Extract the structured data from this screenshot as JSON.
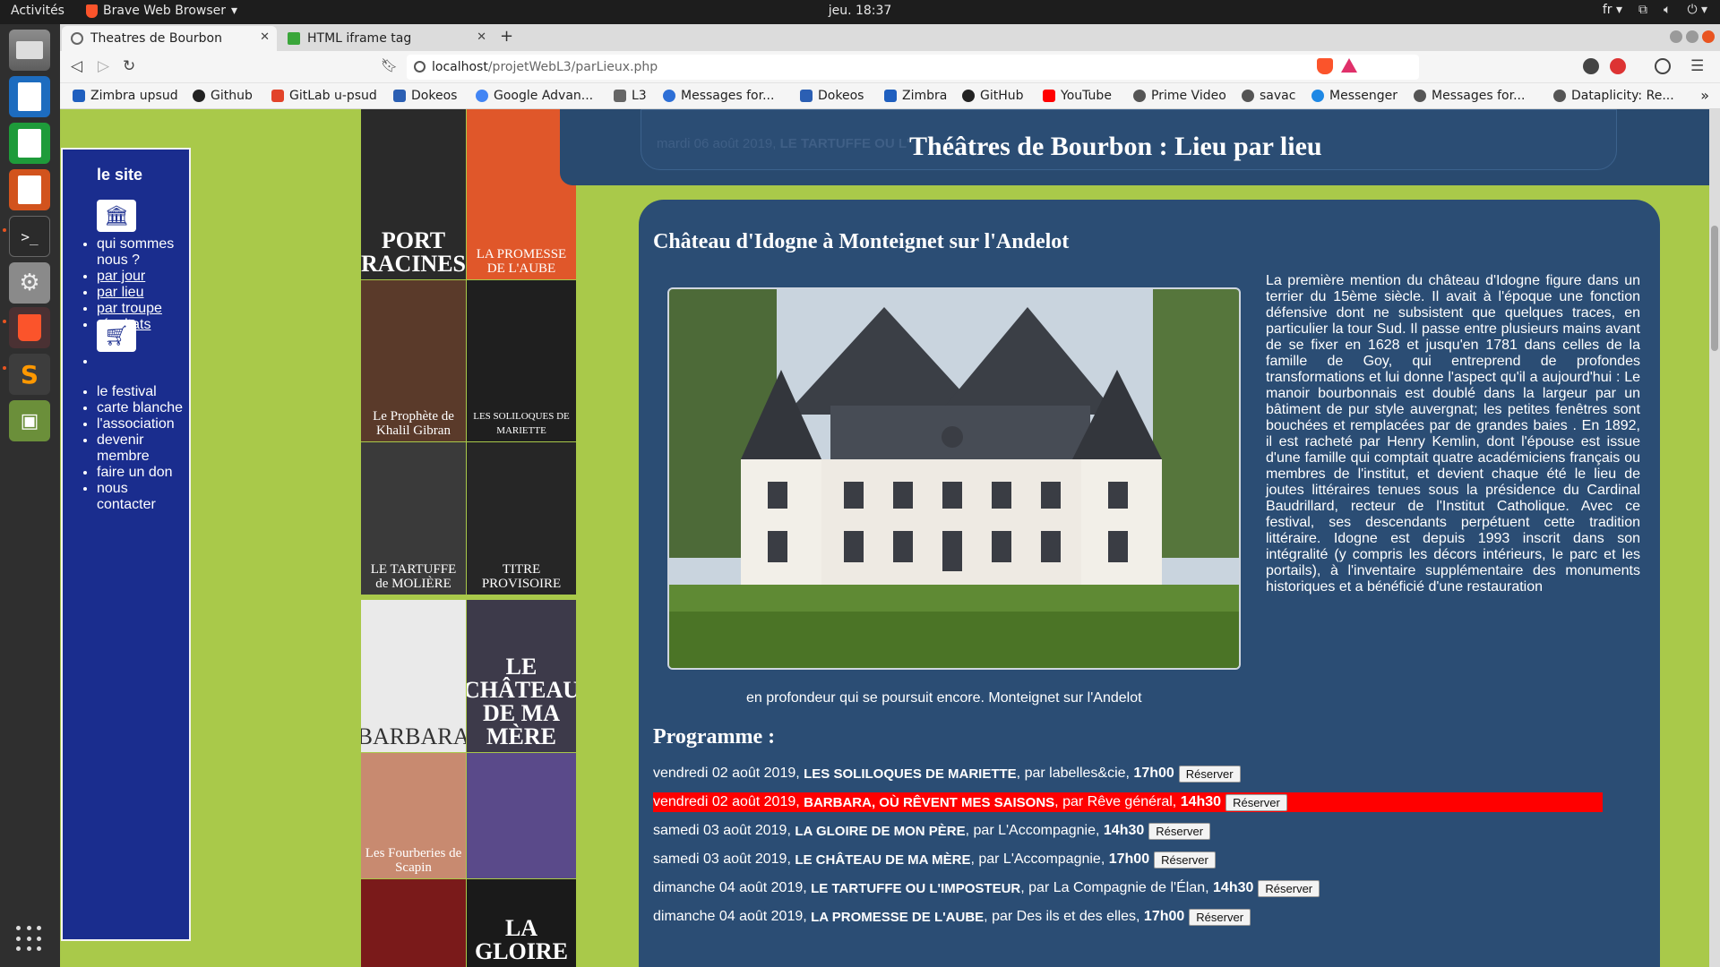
{
  "system": {
    "activities": "Activités",
    "app_name": "Brave Web Browser",
    "clock": "jeu. 18:37",
    "keyboard_layout": "fr"
  },
  "browser": {
    "tabs": [
      {
        "title": "Theatres de Bourbon",
        "active": true
      },
      {
        "title": "HTML iframe tag",
        "active": false
      }
    ],
    "url_host": "localhost",
    "url_path": "/projetWebL3/parLieux.php",
    "bookmarks": [
      {
        "label": "Zimbra upsud",
        "color": "#1f5fbf"
      },
      {
        "label": "Github",
        "color": "#222222"
      },
      {
        "label": "GitLab u-psud",
        "color": "#e24329"
      },
      {
        "label": "Dokeos",
        "color": "#2b5fb3"
      },
      {
        "label": "Google Advan...",
        "color": "#4285f4"
      },
      {
        "label": "L3",
        "color": "#666666"
      },
      {
        "label": "Messages for...",
        "color": "#2d6fd6"
      },
      {
        "label": "Dokeos",
        "color": "#2b5fb3"
      },
      {
        "label": "Zimbra",
        "color": "#1f5fbf"
      },
      {
        "label": "GitHub",
        "color": "#222222"
      },
      {
        "label": "YouTube",
        "color": "#ff0000"
      },
      {
        "label": "Prime Video",
        "color": "#555555"
      },
      {
        "label": "savac",
        "color": "#555555"
      },
      {
        "label": "Messenger",
        "color": "#1e88e5"
      },
      {
        "label": "Messages for...",
        "color": "#555555"
      },
      {
        "label": "Dataplicity: Re...",
        "color": "#555555"
      }
    ]
  },
  "sitenav": {
    "title": "le site",
    "icon1": "theatre-building-icon",
    "icon2": "shopping-cart-icon",
    "links": [
      "qui sommes nous ?",
      "par jour",
      "par lieu",
      "par troupe",
      "résultats"
    ],
    "items": [
      "le festival",
      "carte blanche",
      "l'association",
      "devenir membre",
      "faire un don",
      "nous contacter"
    ]
  },
  "posters": [
    {
      "title": "PORT RACINES",
      "bg": "#2a2a2a"
    },
    {
      "title": "LA PROMESSE DE L'AUBE",
      "bg": "#e0572a"
    },
    {
      "title": "Le Prophète de Khalil Gibran",
      "bg": "#5a3a2a"
    },
    {
      "title": "LES SOLILOQUES DE MARIETTE",
      "bg": "#1f1f1f"
    },
    {
      "title": "LE TARTUFFE de MOLIÈRE",
      "bg": "#3a3a3a"
    },
    {
      "title": "TITRE PROVISOIRE",
      "bg": "#262626"
    },
    {
      "title": "BARBARA",
      "bg": "#eaeaea"
    },
    {
      "title": "LE CHÂTEAU DE MA MÈRE",
      "bg": "#3d3a4a"
    },
    {
      "title": "Les Fourberies de Scapin",
      "bg": "#c88a70"
    },
    {
      "title": "",
      "bg": "#5a4a8a"
    },
    {
      "title": "",
      "bg": "#7a1a1a"
    },
    {
      "title": "LA GLOIRE",
      "bg": "#1a1a1a"
    }
  ],
  "header": {
    "title": "Théâtres de Bourbon : Lieu par lieu",
    "ghost_date": "mardi 06 août 2019,",
    "ghost_play": "LE TARTUFFE OU L'"
  },
  "lieu": {
    "name": "Château d'Idogne à Monteignet sur l'Andelot",
    "description": "La première mention du château d'Idogne figure dans un terrier du 15ème siècle. Il avait à l'époque une fonction défensive dont ne subsistent que quelques traces, en particulier la tour Sud. Il passe entre plusieurs mains avant de se fixer en 1628 et jusqu'en 1781 dans celles de la famille de Goy, qui entreprend de profondes transformations et lui donne l'aspect qu'il a aujourd'hui : Le manoir bourbonnais est doublé dans la largeur par un bâtiment de pur style auvergnat; les petites fenêtres sont bouchées et remplacées par de grandes baies . En 1892, il est racheté par Henry Kemlin, dont l'épouse est issue d'une famille qui comptait quatre académiciens français ou membres de l'institut, et devient chaque été le lieu de joutes littéraires tenues sous la présidence du Cardinal Baudrillard, recteur de l'Institut Catholique. Avec ce festival, ses descendants perpétuent cette tradition littéraire. Idogne est depuis 1993 inscrit dans son intégralité (y compris les décors intérieurs, le parc et les portails), à l'inventaire supplémentaire des monuments historiques et a bénéficié d'une restauration",
    "description_end": "en profondeur qui se poursuit encore. Monteignet sur l'Andelot",
    "programme_title": "Programme :"
  },
  "programme": [
    {
      "date": "vendredi 02 août 2019,",
      "play": "LES SOLILOQUES DE MARIETTE",
      "troupe": ", par labelles&cie,",
      "time": "17h00",
      "button": "Réserver",
      "highlight": false
    },
    {
      "date": "vendredi 02 août 2019,",
      "play": "BARBARA, OÙ RÊVENT MES SAISONS",
      "troupe": " , par Rêve général,",
      "time": "14h30",
      "button": "Réserver",
      "highlight": true
    },
    {
      "date": "samedi 03 août 2019,",
      "play": "LA GLOIRE DE MON PÈRE",
      "troupe": ", par L'Accompagnie,",
      "time": "14h30",
      "button": "Réserver",
      "highlight": false
    },
    {
      "date": "samedi 03 août 2019,",
      "play": "LE CHÂTEAU DE MA MÈRE",
      "troupe": ", par L'Accompagnie,",
      "time": "17h00",
      "button": "Réserver",
      "highlight": false
    },
    {
      "date": "dimanche 04 août 2019,",
      "play": "LE TARTUFFE OU L'IMPOSTEUR",
      "troupe": ", par La Compagnie de l'Élan,",
      "time": "14h30",
      "button": "Réserver",
      "highlight": false
    },
    {
      "date": "dimanche 04 août 2019,",
      "play": "LA PROMESSE DE L'AUBE",
      "troupe": ", par Des ils et des elles,",
      "time": "17h00",
      "button": "Réserver",
      "highlight": false
    }
  ]
}
